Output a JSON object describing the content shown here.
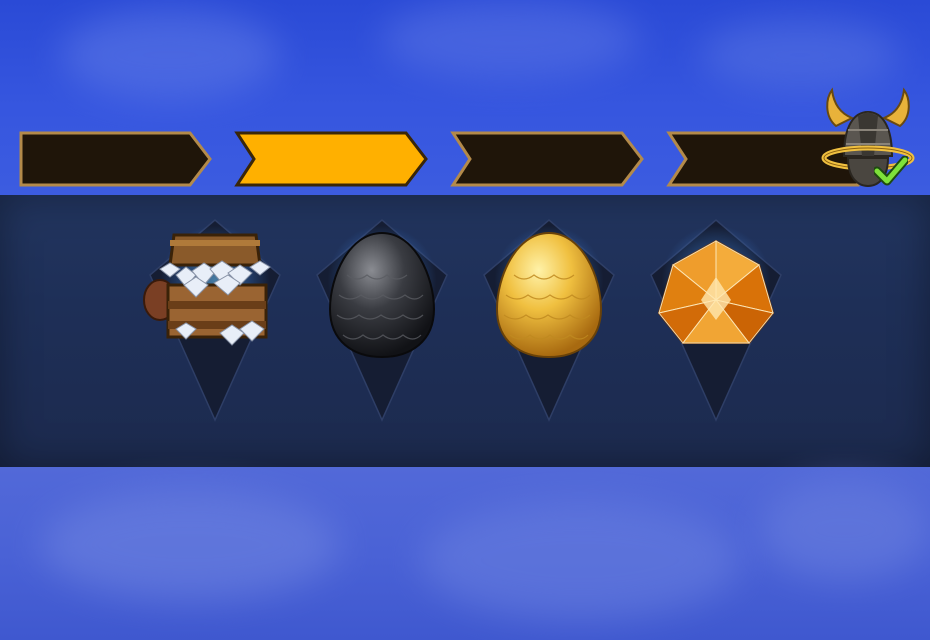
{
  "colors": {
    "step_inactive": "#1f1509",
    "step_active": "#ffb000",
    "step_border": "#b38a4a",
    "panel": "#1e2f57",
    "glow": "#6ec8ff"
  },
  "progress": {
    "steps": [
      {
        "state": "inactive"
      },
      {
        "state": "active"
      },
      {
        "state": "inactive"
      },
      {
        "state": "inactive"
      }
    ],
    "final_reward_icon": "viking-helmet-icon",
    "final_reward_status_icon": "green-check-icon"
  },
  "rewards": [
    {
      "icon": "treasure-chest-diamonds-icon"
    },
    {
      "icon": "black-dragon-egg-icon"
    },
    {
      "icon": "golden-dragon-egg-icon"
    },
    {
      "icon": "orange-gem-icon"
    }
  ]
}
